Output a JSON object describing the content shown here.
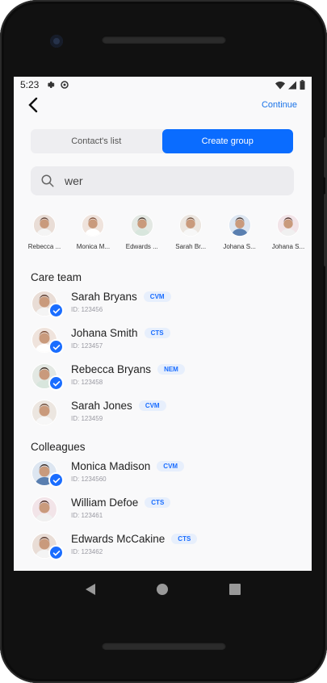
{
  "status_bar": {
    "time": "5:23"
  },
  "header": {
    "continue_label": "Continue"
  },
  "tabs": [
    {
      "label": "Contact's list",
      "active": false
    },
    {
      "label": "Create group",
      "active": true
    }
  ],
  "search": {
    "value": "wer"
  },
  "selected_strip": [
    {
      "name": "Rebecca ..."
    },
    {
      "name": "Monica M..."
    },
    {
      "name": "Edwards ..."
    },
    {
      "name": "Sarah Br..."
    },
    {
      "name": "Johana S..."
    },
    {
      "name": "Johana S..."
    }
  ],
  "sections": [
    {
      "title": "Care team",
      "contacts": [
        {
          "name": "Sarah Bryans",
          "badge": "CVM",
          "id": "ID: 123456",
          "selected": true
        },
        {
          "name": "Johana Smith",
          "badge": "CTS",
          "id": "ID: 123457",
          "selected": true
        },
        {
          "name": "Rebecca Bryans",
          "badge": "NEM",
          "id": "ID: 123458",
          "selected": true
        },
        {
          "name": "Sarah Jones",
          "badge": "CVM",
          "id": "ID: 123459",
          "selected": false
        }
      ]
    },
    {
      "title": "Colleagues",
      "contacts": [
        {
          "name": "Monica Madison",
          "badge": "CVM",
          "id": "ID: 1234560",
          "selected": true
        },
        {
          "name": "William Defoe",
          "badge": "CTS",
          "id": "ID: 123461",
          "selected": false
        },
        {
          "name": "Edwards McCakine",
          "badge": "CTS",
          "id": "ID: 123462",
          "selected": true
        }
      ]
    }
  ],
  "colors": {
    "accent": "#0a6cff",
    "badge_bg": "#e7effc",
    "screen_bg": "#f9f9fa"
  }
}
